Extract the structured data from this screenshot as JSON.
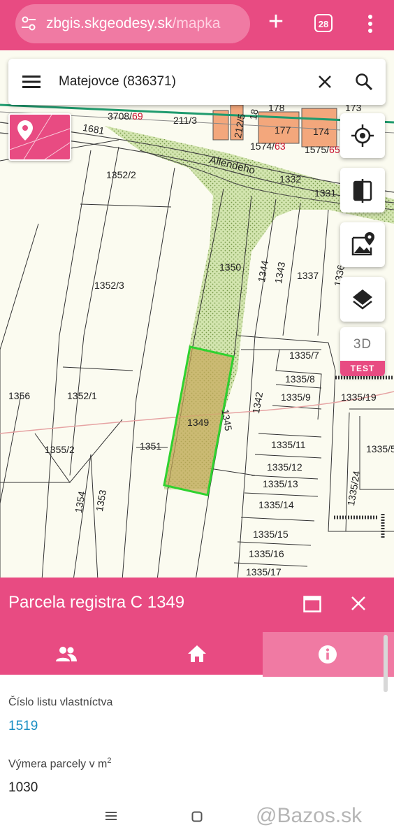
{
  "browser": {
    "url_main": "zbgis.skgeodesy.sk",
    "url_rest": "/mapka",
    "tab_count": "28",
    "colors": {
      "bar": "#e84b82",
      "pill": "#f07aa3"
    }
  },
  "search": {
    "value": "Matejovce (836371)"
  },
  "map": {
    "street": "Allendeho",
    "parcels": {
      "p3708": "3708/",
      "p3708_sfx": "69",
      "p211": "211/3",
      "p212": "212/5",
      "p177": "177",
      "p174": "174",
      "p1574": "1574/",
      "p1574_sfx": "63",
      "p1575": "1575/",
      "p1575_sfx": "65",
      "p1681": "1681",
      "p1332": "1332",
      "p1331": "1331",
      "p1352_2": "1352/2",
      "p1352_3": "1352/3",
      "p1352_1": "1352/1",
      "p1350": "1350",
      "p1344": "1344",
      "p1343": "1343",
      "p1337": "1337",
      "p1336": "1336",
      "p1335_7": "1335/7",
      "p1335_8": "1335/8",
      "p1335_9": "1335/9",
      "p1335_19": "1335/19",
      "p1356": "1356",
      "p1349": "1349",
      "p1345": "1345",
      "p1342": "1342",
      "p1355_2": "1355/2",
      "p1351": "1351",
      "p1335_11": "1335/11",
      "p1335_5": "1335/5",
      "p1335_12": "1335/12",
      "p1335_13": "1335/13",
      "p1335_24": "1335/24",
      "p1335_14": "1335/14",
      "p1354": "1354",
      "p1353": "1353",
      "p1335_15": "1335/15",
      "p1335_16": "1335/16",
      "p1335_17": "1335/17",
      "p173": "173",
      "p178": "178",
      "pA": "18"
    }
  },
  "buttons": {
    "three_d": "3D",
    "test": "TEST"
  },
  "panel": {
    "title": "Parcela registra C 1349",
    "tabs": [
      "owners",
      "building",
      "info"
    ],
    "fields": [
      {
        "label": "Číslo listu vlastníctva",
        "value": "1519"
      },
      {
        "label": "Výmera parcely v m",
        "label_sup": "2",
        "value": "1030"
      }
    ]
  },
  "watermark": "@Bazos.sk",
  "icons": [
    "tune-icon",
    "plus-icon",
    "tab-count-icon",
    "more-vert-icon",
    "menu-icon",
    "close-icon",
    "search-icon",
    "location-target-icon",
    "compare-icon",
    "map-photo-icon",
    "layers-icon",
    "maximize-icon",
    "people-icon",
    "home-icon",
    "info-icon"
  ],
  "accent": "#e84b82",
  "link_color": "#1a8fc4"
}
